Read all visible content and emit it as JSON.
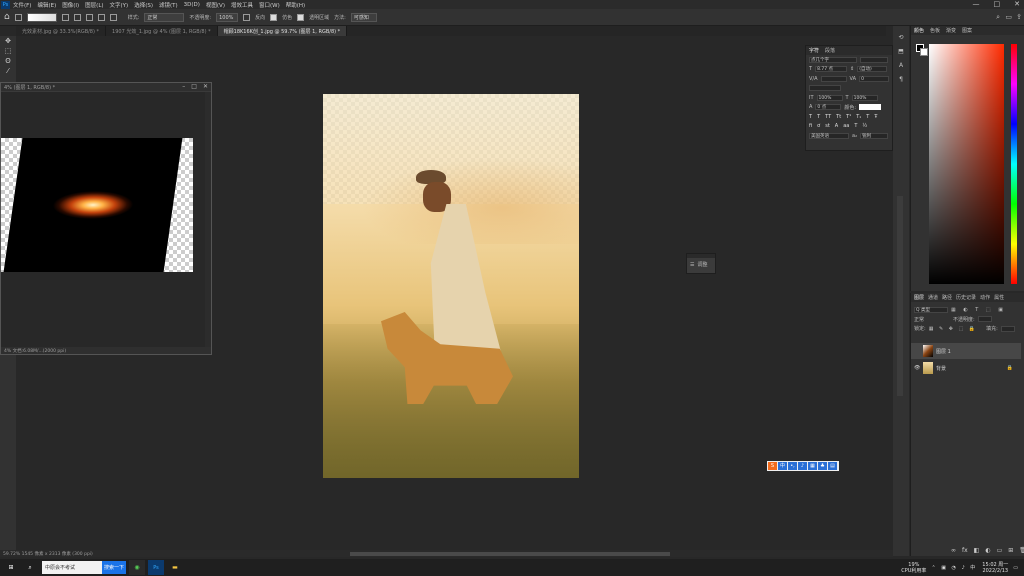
{
  "app": {
    "logo": "Ps"
  },
  "menubar": {
    "items": [
      "文件(F)",
      "编辑(E)",
      "图像(I)",
      "图层(L)",
      "文字(Y)",
      "选择(S)",
      "滤镜(T)",
      "3D(D)",
      "视图(V)",
      "增效工具",
      "窗口(W)",
      "帮助(H)"
    ],
    "controls": [
      "—",
      "□",
      "✕"
    ]
  },
  "options": {
    "style_label": "样式:",
    "style_value": "正常",
    "width_label": "宽度:",
    "opacity_label": "不透明度:",
    "opacity_value": "100%",
    "reverse": "反向",
    "dither": "仿色",
    "transparency": "透明区域",
    "mode_label": "方法:",
    "mode_value": "可感知"
  },
  "tabs": [
    "光效素材.jpg @ 33.3%(RGB/8) *",
    "1907 光效_1.jpg @ 4% (图层 1, RGB/8) *",
    "帽顾18K16K创_1.jpg @ 59.7% (图层 1, RGB/8) *"
  ],
  "floatwin": {
    "title": "4% (图层 1, RGB/8) *",
    "status": "4% 文档:6.08M/...(2000 ppi)"
  },
  "char_panel": {
    "tabs": [
      "字符",
      "段落"
    ],
    "font": "点几个字",
    "size": "8.77 点",
    "leading": "(自动)",
    "tracking": "0",
    "scale_v": "100%",
    "scale_h": "100%",
    "baseline": "0 点",
    "color_label": "颜色:",
    "lang": "美国英语",
    "aa": "锐利"
  },
  "mini_panel": {
    "label": "调整"
  },
  "color_panel": {
    "tabs": [
      "颜色",
      "色板",
      "渐变",
      "图案"
    ]
  },
  "layers_panel": {
    "tabs": [
      "图层",
      "通道",
      "路径",
      "历史记录",
      "动作",
      "属性"
    ],
    "kind": "Q 类型",
    "mode": "正常",
    "opacity_label": "不透明度:",
    "fill_label": "填充:",
    "lock_label": "锁定:",
    "layers": [
      {
        "name": "图层 1"
      },
      {
        "name": "背景"
      }
    ]
  },
  "statusbar": {
    "text": "59.72%   1545 像素 x 2313 像素 (300 ppi)"
  },
  "taskbar": {
    "search_text": "中原会不考试",
    "search_button": "搜索一下",
    "cpu": "19%",
    "cpu_label": "CPU利用率",
    "time": "15:02 周一",
    "date": "2022/2/13"
  }
}
